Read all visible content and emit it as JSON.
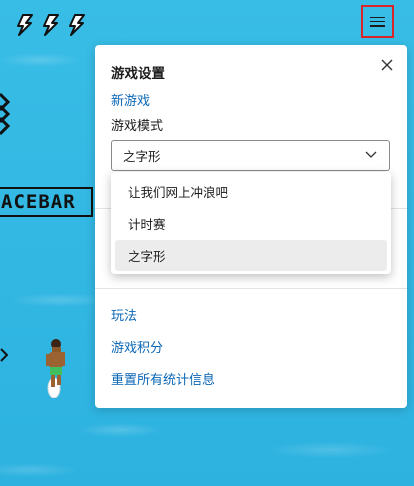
{
  "header": {
    "lives_icons": [
      "lightning-bolt-icon",
      "lightning-bolt-icon",
      "lightning-bolt-icon"
    ],
    "menu_button_icon": "hamburger-menu-icon"
  },
  "game": {
    "spacebar_text": "ACEBAR"
  },
  "settings_panel": {
    "title": "游戏设置",
    "new_game_label": "新游戏",
    "mode_label": "游戏模式",
    "mode_selected": "之字形",
    "mode_options": [
      "让我们网上冲浪吧",
      "计时赛",
      "之字形"
    ],
    "how_to_play_label": "玩法",
    "stats_label": "游戏积分",
    "reset_stats_label": "重置所有统计信息"
  },
  "colors": {
    "water": "#2fb6e3",
    "link": "#0a66b6",
    "highlight_border": "#d9262a"
  }
}
